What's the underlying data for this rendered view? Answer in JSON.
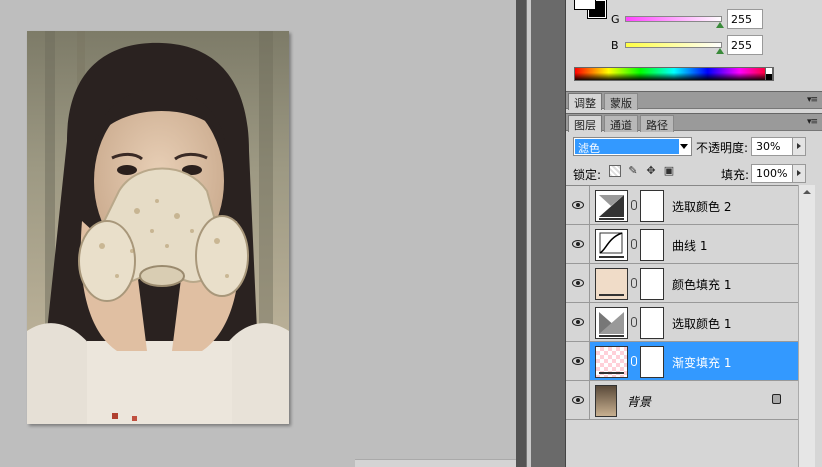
{
  "color_panel": {
    "sliders": [
      {
        "label": "G",
        "value": "255",
        "gradient": [
          "#ff44ff",
          "#ffffff"
        ]
      },
      {
        "label": "B",
        "value": "255",
        "gradient": [
          "#ffff44",
          "#ffffff"
        ]
      }
    ]
  },
  "adjust_tabs": [
    "调整",
    "蒙版"
  ],
  "layers_tabs": [
    "图层",
    "通道",
    "路径"
  ],
  "blend_mode": "滤色",
  "opacity": {
    "label": "不透明度:",
    "value": "30%"
  },
  "lock": {
    "label": "锁定:"
  },
  "fill": {
    "label": "填充:",
    "value": "100%"
  },
  "layers": [
    {
      "name": "选取颜色 2",
      "type": "selective-color",
      "selected": false
    },
    {
      "name": "曲线 1",
      "type": "curves",
      "selected": false
    },
    {
      "name": "颜色填充 1",
      "type": "solid-color",
      "color": "#f0dcc8",
      "selected": false
    },
    {
      "name": "选取颜色 1",
      "type": "selective-color",
      "selected": false
    },
    {
      "name": "渐变填充 1",
      "type": "gradient",
      "selected": true
    },
    {
      "name": "背景",
      "type": "background",
      "selected": false
    }
  ],
  "colors": {
    "selection": "#3399ff",
    "panel": "#d6d6d6"
  }
}
